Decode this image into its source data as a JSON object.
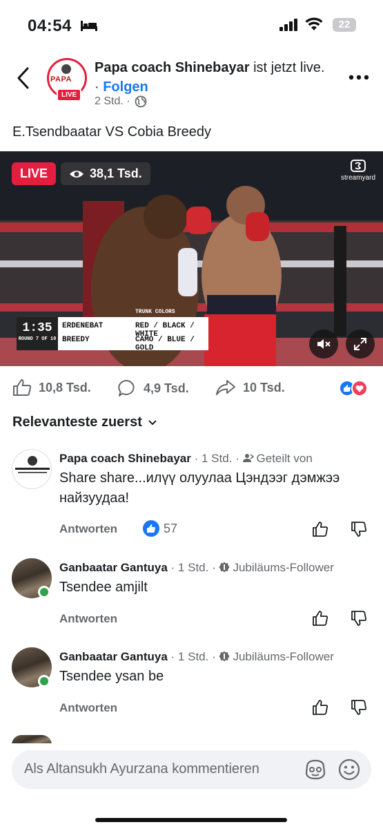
{
  "status_bar": {
    "time": "04:54",
    "battery": "22"
  },
  "post": {
    "author": "Papa coach Shinebayar",
    "status_suffix": " ist jetzt live. · ",
    "follow_label": "Folgen",
    "time": "2 Std. ·",
    "title": "E.Tsendbaatar VS Cobia Breedy",
    "avatar_logo_text": "PAPA",
    "avatar_live_label": "LIVE"
  },
  "video": {
    "live_label": "LIVE",
    "viewers": "38,1 Tsd.",
    "watermark": "streamyard",
    "scorebug": {
      "clock": "1:35",
      "round": "ROUND 7 OF 10",
      "header": "TRUNK COLORS",
      "fighter1": "ERDENEBAT",
      "fighter1_colors": "RED / BLACK / WHITE",
      "fighter2": "BREEDY",
      "fighter2_colors": "CAMO / BLUE / GOLD"
    }
  },
  "reactions": {
    "likes": "10,8 Tsd.",
    "comments": "4,9 Tsd.",
    "shares": "10 Tsd."
  },
  "sort_label": "Relevanteste zuerst",
  "comments": [
    {
      "name": "Papa coach Shinebayar",
      "meta": " · 1 Std. · ",
      "badge": "Geteilt von",
      "text": "Share share...илүү олуулаа Цэндээг дэмжээ найзуудаа!",
      "reply": "Antworten",
      "likes": "57"
    },
    {
      "name": "Ganbaatar Gantuya",
      "meta": " · 1 Std. · ",
      "badge": "Jubiläums-Follower",
      "text": "Tsendee amjilt",
      "reply": "Antworten"
    },
    {
      "name": "Ganbaatar Gantuya",
      "meta": " · 1 Std. · ",
      "badge": "Jubiläums-Follower",
      "text": "Tsendee ysan be",
      "reply": "Antworten"
    }
  ],
  "composer": {
    "placeholder": "Als Altansukh Ayurzana kommentieren"
  },
  "colors": {
    "accent": "#1877f2",
    "live": "#e41e3f",
    "online": "#31a24c"
  }
}
